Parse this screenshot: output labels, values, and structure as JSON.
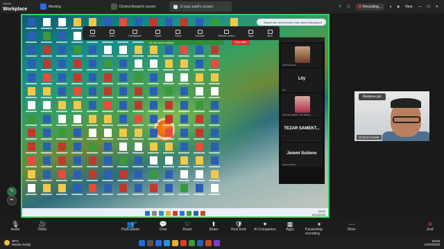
{
  "app": {
    "brand_top": "zoom",
    "brand_bottom": "Workplace"
  },
  "tabs": [
    {
      "label": "Meeting",
      "color": "#2d6cdf"
    },
    {
      "label": "Chotrul Ansarti's screen",
      "color": "#3a3a3a"
    },
    {
      "label": "U nusu saeti's screen",
      "color": "#2e2e2e"
    }
  ],
  "top_right": {
    "recording": "Recording...",
    "view": "View"
  },
  "shared_screen": {
    "search_placeholder": "Search the web to learn more about this picture",
    "sharing_text": "You are screen sharing",
    "stop_share": "Stop share",
    "toolbar": [
      "Audio",
      "Video",
      "Participants",
      "Share",
      "Pause",
      "Annotate",
      "Remote control",
      "Apps",
      "More"
    ],
    "gallery": [
      {
        "name": "Chotrul Ansarti",
        "kind": "photo"
      },
      {
        "name": "Lily",
        "kind": "label"
      },
      {
        "name": "Fitra Nur Isnaeni, UPN Malang",
        "kind": "photo"
      },
      {
        "name": "TEZAR SAMEKT...",
        "kind": "label"
      },
      {
        "name": "Jemmi Sutiono",
        "kind": "label"
      }
    ],
    "inner_clock": {
      "time": "20:53",
      "date": "14/04/2026"
    }
  },
  "speaker": {
    "pin_label": "Remove pin",
    "name": "Chotrul Ansarti"
  },
  "controls": [
    {
      "label": "Audio",
      "icon": "mic-icon",
      "glyph": "🎙"
    },
    {
      "label": "Video",
      "icon": "video-icon",
      "glyph": "🎥"
    },
    {
      "label": "Participants",
      "icon": "participants-icon",
      "glyph": "👥",
      "count": "92"
    },
    {
      "label": "Chat",
      "icon": "chat-icon",
      "glyph": "💬"
    },
    {
      "label": "React",
      "icon": "react-icon",
      "glyph": "♡"
    },
    {
      "label": "Share",
      "icon": "share-icon",
      "glyph": "⬆"
    },
    {
      "label": "Host tools",
      "icon": "shield-icon",
      "glyph": "🛡"
    },
    {
      "label": "AI Companion",
      "icon": "sparkle-icon",
      "glyph": "✦"
    },
    {
      "label": "Apps",
      "icon": "apps-icon",
      "glyph": "▦"
    },
    {
      "label": "Pause/stop recording",
      "icon": "pause-icon",
      "glyph": "⏸"
    },
    {
      "label": "More",
      "icon": "more-icon",
      "glyph": "⋯"
    },
    {
      "label": "End",
      "icon": "end-icon",
      "glyph": "✕"
    }
  ],
  "weather": {
    "temp": "28°C",
    "desc": "Mostly cloudy"
  },
  "clock": {
    "time": "20:53",
    "date": "14/04/2026"
  },
  "colors": {
    "green_frame": "#2fd35a",
    "accent_blue": "#2d6cdf",
    "end_red": "#e24040"
  }
}
